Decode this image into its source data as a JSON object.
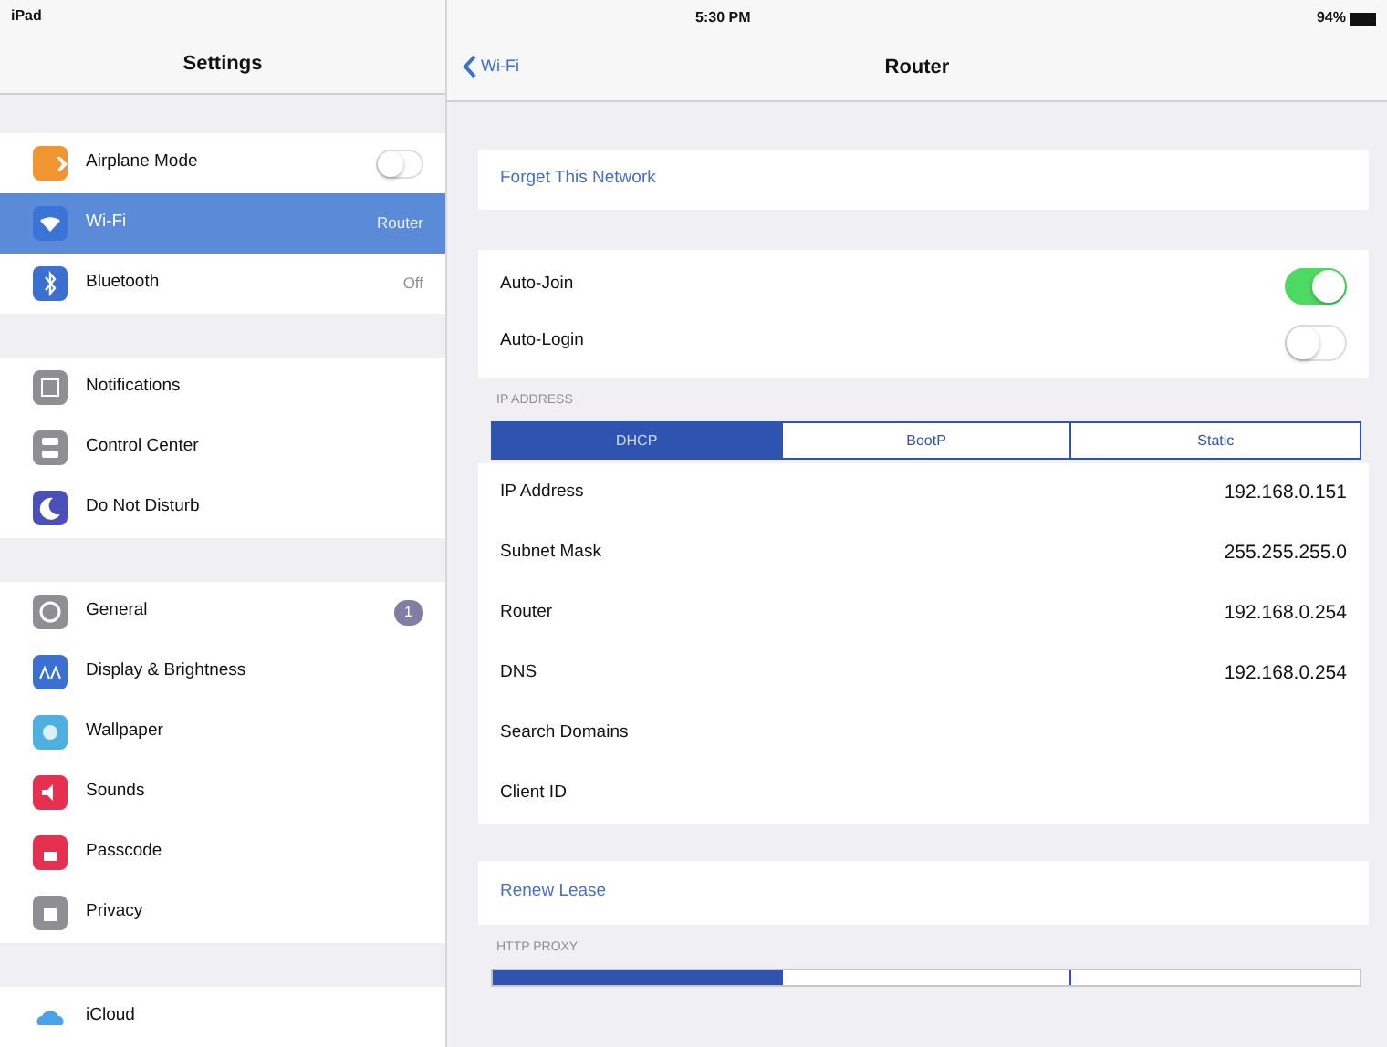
{
  "status_bar": {
    "device": "iPad",
    "time": "5:30 PM",
    "battery": "94%"
  },
  "sidebar": {
    "title": "Settings",
    "groups": [
      [
        {
          "label": "Airplane Mode",
          "color": "#f0952f",
          "kind": "toggle",
          "on": false,
          "selected": false
        },
        {
          "label": "Wi-Fi",
          "color": "#3b73d6",
          "kind": "detail",
          "detail": "Router",
          "selected": true
        },
        {
          "label": "Bluetooth",
          "color": "#3b6fd0",
          "kind": "detail",
          "detail": "Off",
          "selected": false
        }
      ],
      [
        {
          "label": "Notifications",
          "color": "#8e8e93",
          "kind": "plain",
          "selected": false
        },
        {
          "label": "Control Center",
          "color": "#8e8e93",
          "kind": "plain",
          "selected": false
        },
        {
          "label": "Do Not Disturb",
          "color": "#4b4fb8",
          "kind": "plain",
          "selected": false
        }
      ],
      [
        {
          "label": "General",
          "color": "#8e8e93",
          "kind": "badge",
          "badge": "1",
          "selected": false
        },
        {
          "label": "Display & Brightness",
          "color": "#3b6fd0",
          "kind": "plain",
          "selected": false
        },
        {
          "label": "Wallpaper",
          "color": "#4eb0e0",
          "kind": "plain",
          "selected": false
        },
        {
          "label": "Sounds",
          "color": "#e5304f",
          "kind": "plain",
          "selected": false
        },
        {
          "label": "Passcode",
          "color": "#e5304f",
          "kind": "plain",
          "selected": false
        },
        {
          "label": "Privacy",
          "color": "#8e8e93",
          "kind": "plain",
          "selected": false
        }
      ],
      [
        {
          "label": "iCloud",
          "color": "#ffffff",
          "kind": "plain",
          "selected": false
        }
      ]
    ]
  },
  "detail": {
    "back": "Wi-Fi",
    "title": "Router",
    "forget": "Forget This Network",
    "switches": [
      {
        "label": "Auto-Join",
        "on": true
      },
      {
        "label": "Auto-Login",
        "on": false
      }
    ],
    "ip_header": "IP ADDRESS",
    "ip_segments": [
      {
        "label": "DHCP",
        "selected": true
      },
      {
        "label": "BootP",
        "selected": false
      },
      {
        "label": "Static",
        "selected": false
      }
    ],
    "ip_rows": [
      {
        "label": "IP Address",
        "value": "192.168.0.151"
      },
      {
        "label": "Subnet Mask",
        "value": "255.255.255.0"
      },
      {
        "label": "Router",
        "value": "192.168.0.254"
      },
      {
        "label": "DNS",
        "value": "192.168.0.254"
      },
      {
        "label": "Search Domains"
      },
      {
        "label": "Client ID"
      }
    ],
    "renew": "Renew Lease",
    "proxy_header": "HTTP PROXY",
    "proxy_segments": [
      {
        "selected": true
      },
      {
        "selected": false
      },
      {
        "selected": false
      }
    ]
  }
}
